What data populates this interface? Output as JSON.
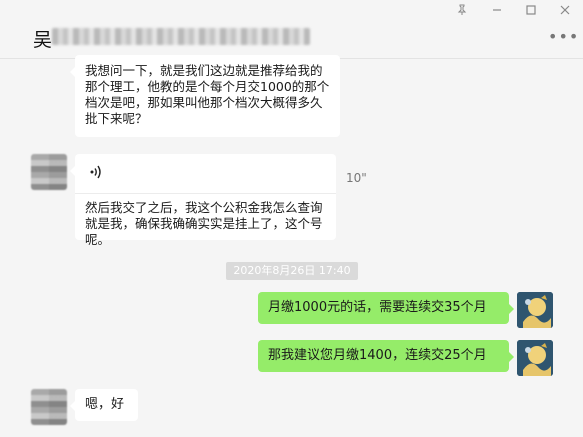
{
  "window": {
    "contact_name": "吴",
    "pin_icon": "pin-icon",
    "minimize_icon": "minimize-icon",
    "maximize_icon": "maximize-icon",
    "close_icon": "close-icon",
    "more_icon": "more-icon"
  },
  "messages": {
    "m1_text": "我想问一下，就是我们这边就是推荐给我的那个理工，他教的是个每个月交1000的那个档次是吧，那如果叫他那个档次大概得多久批下来呢？",
    "m2_voice_icon": "voice-wave-icon",
    "m2_duration": "10\"",
    "m2_text": "然后我交了之后，我这个公积金我怎么查询就是我，确保我确确实实是挂上了，这个号呢。",
    "timestamp": "2020年8月26日 17:40",
    "m3_text": "月缴1000元的话，需要连续交35个月",
    "m4_text": "那我建议您月缴1400，连续交25个月",
    "m5_text": "嗯，好"
  },
  "colors": {
    "background": "#f5f5f5",
    "bubble_self": "#95ec69",
    "bubble_other": "#ffffff",
    "timestamp_bg": "#dadada"
  }
}
